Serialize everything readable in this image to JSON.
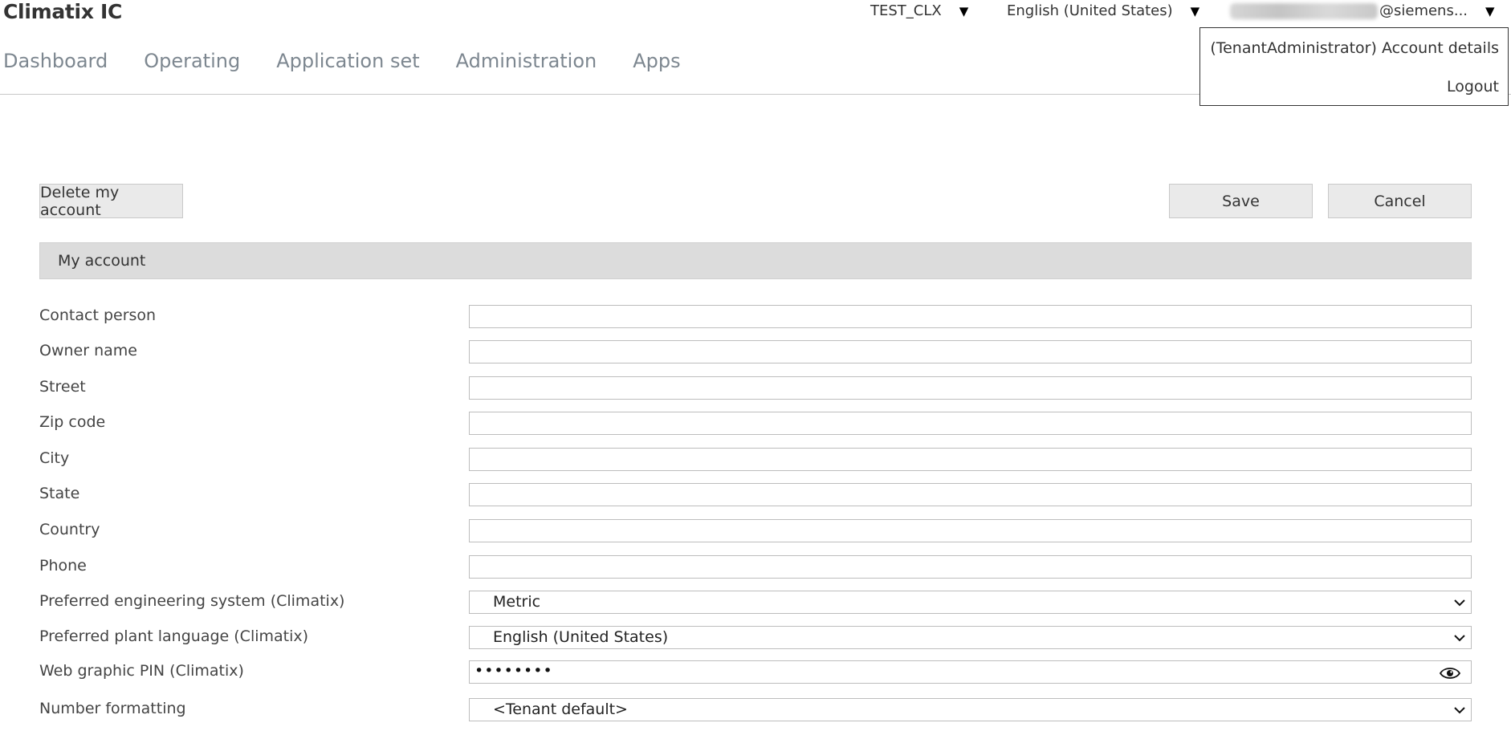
{
  "app": {
    "title": "Climatix IC"
  },
  "header": {
    "tenant": "TEST_CLX",
    "language": "English (United States)",
    "account_domain": "@siemens..."
  },
  "nav": [
    "Dashboard",
    "Operating",
    "Application set",
    "Administration",
    "Apps"
  ],
  "account_menu": {
    "items": [
      "(TenantAdministrator) Account details",
      "Logout"
    ]
  },
  "actions": {
    "delete": "Delete my account",
    "save": "Save",
    "cancel": "Cancel"
  },
  "section": {
    "title": "My account"
  },
  "form": {
    "fields": [
      {
        "label": "Contact person",
        "type": "text",
        "value": ""
      },
      {
        "label": "Owner name",
        "type": "text",
        "value": ""
      },
      {
        "label": "Street",
        "type": "text",
        "value": ""
      },
      {
        "label": "Zip code",
        "type": "text",
        "value": ""
      },
      {
        "label": "City",
        "type": "text",
        "value": ""
      },
      {
        "label": "State",
        "type": "text",
        "value": ""
      },
      {
        "label": "Country",
        "type": "text",
        "value": ""
      },
      {
        "label": "Phone",
        "type": "text",
        "value": ""
      },
      {
        "label": "Preferred engineering system (Climatix)",
        "type": "select",
        "value": "Metric"
      },
      {
        "label": "Preferred plant language (Climatix)",
        "type": "select",
        "value": "English (United States)"
      },
      {
        "label": "Web graphic PIN (Climatix)",
        "type": "password",
        "value": "••••••••"
      },
      {
        "label": "Number formatting",
        "type": "select",
        "value": "<Tenant default>"
      }
    ]
  },
  "icons": {
    "dropdown": "triangle-down-icon",
    "select": "chevron-down-icon",
    "reveal": "eye-icon"
  }
}
